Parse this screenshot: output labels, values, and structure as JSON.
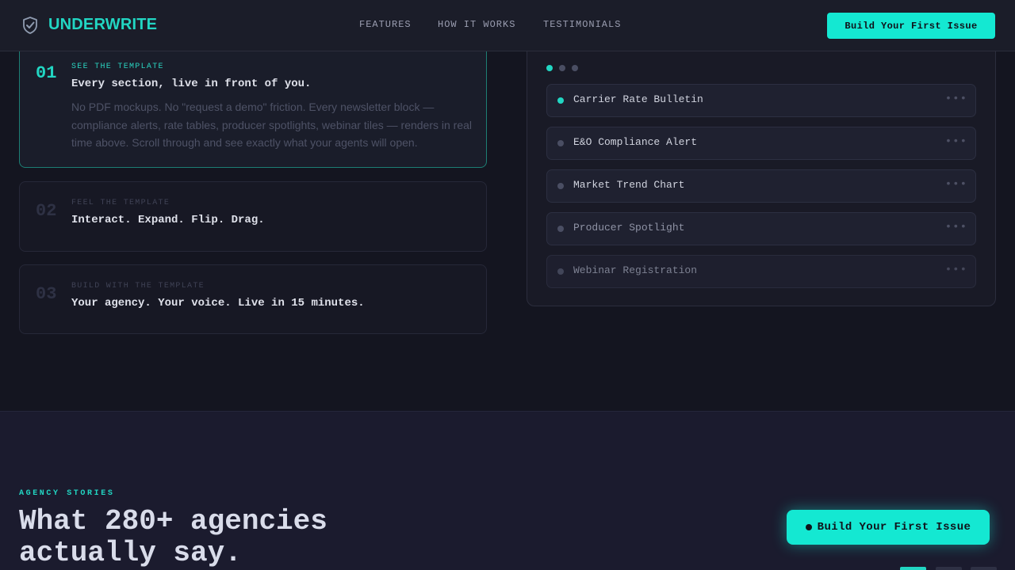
{
  "header": {
    "logo_text": "UNDERWRITE",
    "logo_icon": "shield-check-icon",
    "nav": [
      "FEATURES",
      "HOW IT WORKS",
      "TESTIMONIALS"
    ],
    "cta_label": "Build Your First Issue"
  },
  "steps": [
    {
      "number": "01",
      "kicker": "SEE THE TEMPLATE",
      "title": "Every section, live in front of you.",
      "description": "No PDF mockups. No \"request a demo\" friction. Every newsletter block — compliance alerts, rate tables, producer spotlights, webinar tiles — renders in real time above. Scroll through and see exactly what your agents will open.",
      "active": true
    },
    {
      "number": "02",
      "kicker": "FEEL THE TEMPLATE",
      "title": "Interact. Expand. Flip. Drag.",
      "active": false
    },
    {
      "number": "03",
      "kicker": "BUILD WITH THE TEMPLATE",
      "title": "Your agency. Your voice. Live in 15 minutes.",
      "active": false
    }
  ],
  "preview": {
    "active_dot_index": 0,
    "blocks": [
      {
        "label": "Carrier Rate Bulletin",
        "menu": "•••",
        "active": true
      },
      {
        "label": "E&O Compliance Alert",
        "menu": "•••",
        "active": false
      },
      {
        "label": "Market Trend Chart",
        "menu": "•••",
        "active": false
      },
      {
        "label": "Producer Spotlight",
        "menu": "•••",
        "active": false
      },
      {
        "label": "Webinar Registration",
        "menu": "•••",
        "active": false
      }
    ]
  },
  "stories": {
    "eyebrow": "AGENCY STORIES",
    "heading_line1": "What 280+ agencies",
    "heading_line2": "actually say."
  },
  "floating_cta": {
    "label": "Build Your First Issue"
  },
  "pager": {
    "count": 3,
    "active_index": 0
  },
  "colors": {
    "accent": "#14e8d2",
    "accent_text": "#22d6c3",
    "background": "#141520",
    "lower_background": "#1b1b2e"
  }
}
